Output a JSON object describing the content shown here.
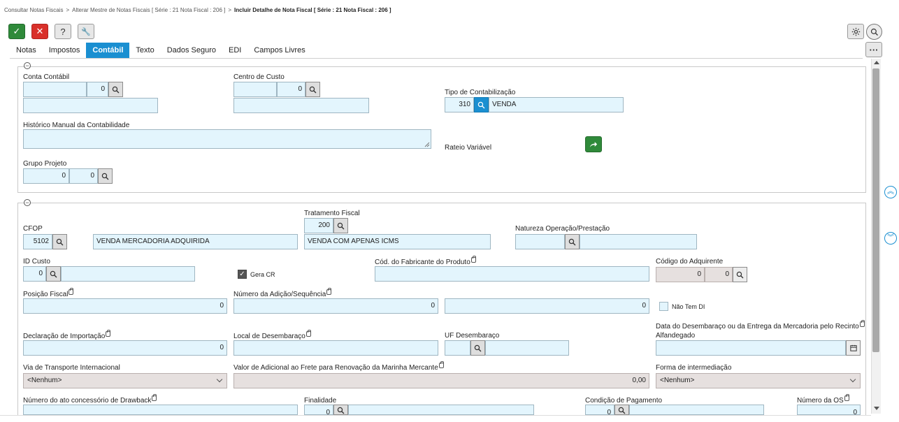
{
  "breadcrumb": {
    "items": [
      "Consultar Notas Fiscais",
      "Alterar Mestre de Notas Fiscais [ Série : 21 Nota Fiscal : 206 ]",
      "Incluir Detalhe de Nota Fiscal [ Série : 21 Nota Fiscal : 206 ]"
    ],
    "separator": ">"
  },
  "toolbar": {
    "confirm": "✓",
    "cancel": "✕",
    "help": "?",
    "tools": "🔧"
  },
  "top_right": {
    "more": "···"
  },
  "tabs": [
    "Notas",
    "Impostos",
    "Contábil",
    "Texto",
    "Dados Seguro",
    "EDI",
    "Campos Livres"
  ],
  "active_tab": "Contábil",
  "section1": {
    "conta_contabil": {
      "label": "Conta Contábil",
      "code": "",
      "number": "0",
      "description": ""
    },
    "centro_custo": {
      "label": "Centro de Custo",
      "code": "",
      "number": "0",
      "description": ""
    },
    "tipo_contabilizacao": {
      "label": "Tipo de Contabilização",
      "code": "310",
      "description": "VENDA"
    },
    "historico": {
      "label": "Histórico Manual da Contabilidade",
      "value": ""
    },
    "rateio": {
      "label": "Rateio Variável"
    },
    "grupo_projeto": {
      "label": "Grupo Projeto",
      "value1": "0",
      "value2": "0"
    }
  },
  "section2": {
    "tratamento_fiscal": {
      "label": "Tratamento Fiscal",
      "code": "200",
      "description": "VENDA COM APENAS ICMS"
    },
    "cfop": {
      "label": "CFOP",
      "code": "5102",
      "description": "VENDA MERCADORIA ADQUIRIDA"
    },
    "natureza": {
      "label": "Natureza Operação/Prestação",
      "code": "",
      "description": ""
    },
    "id_custo": {
      "label": "ID Custo",
      "value": "0",
      "description": ""
    },
    "gera_cr": {
      "label": "Gera CR",
      "checked": true
    },
    "cod_fabricante": {
      "label": "Cód. do Fabricante do Produto",
      "value": ""
    },
    "codigo_adquirente": {
      "label": "Código do Adquirente",
      "value1": "0",
      "value2": "0"
    },
    "posicao_fiscal": {
      "label": "Posição Fiscal",
      "value": "0"
    },
    "numero_adicao": {
      "label": "Número da Adição/Sequência",
      "value1": "0",
      "value2": "0"
    },
    "nao_tem_di": {
      "label": "Não Tem DI",
      "checked": false
    },
    "declaracao_importacao": {
      "label": "Declaração de Importação",
      "value": "0"
    },
    "local_desembaraco": {
      "label": "Local de Desembaraço",
      "value": ""
    },
    "uf_desembaraco": {
      "label": "UF Desembaraço",
      "code": "",
      "description": ""
    },
    "data_desembaraco": {
      "label_line1": "Data do Desembaraço ou da Entrega da Mercadoria pelo Recinto",
      "label_line2": "Alfandegado",
      "value": ""
    },
    "via_transporte": {
      "label": "Via de Transporte Internacional",
      "value": "<Nenhum>"
    },
    "valor_adicional_frete": {
      "label": "Valor de Adicional ao Frete para Renovação da Marinha Mercante",
      "value": "0,00"
    },
    "forma_intermediacao": {
      "label": "Forma de intermediação",
      "value": "<Nenhum>"
    },
    "numero_ato": {
      "label": "Número do ato concessório de Drawback",
      "value": ""
    },
    "finalidade": {
      "label": "Finalidade",
      "code": "0",
      "description": ""
    },
    "condicao_pagamento": {
      "label": "Condição de Pagamento",
      "code": "0",
      "description": ""
    },
    "numero_os": {
      "label": "Número da OS",
      "value": "0"
    }
  },
  "colors": {
    "accent": "#1a8fd1",
    "confirm": "#2f8a3a",
    "cancel": "#d9302a",
    "input_bg": "#e3f5fd"
  }
}
